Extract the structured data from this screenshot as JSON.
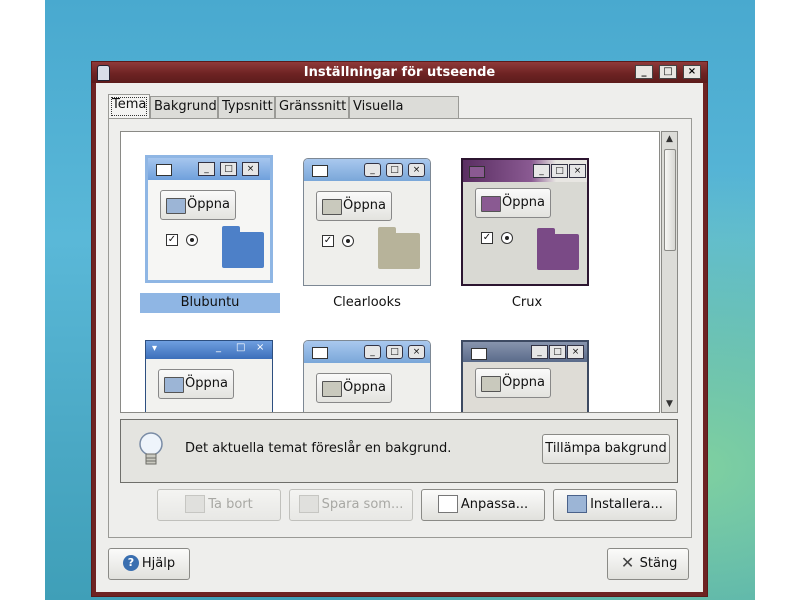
{
  "window": {
    "title": "Inställningar för utseende",
    "controls": {
      "minimize": "_",
      "maximize": "□",
      "close": "×"
    }
  },
  "tabs": [
    {
      "label": "Tema",
      "active": true
    },
    {
      "label": "Bakgrund"
    },
    {
      "label": "Typsnitt"
    },
    {
      "label": "Gränssnitt"
    },
    {
      "label": "Visuella effekter"
    }
  ],
  "themes": [
    {
      "name": "Blubuntu",
      "button_label": "Öppna",
      "selected": true,
      "colors": {
        "frame": "#6fa0dc",
        "folder": "#4d80c8"
      }
    },
    {
      "name": "Clearlooks",
      "button_label": "Öppna",
      "colors": {
        "frame": "#7aa7d9",
        "folder": "#b7b39a"
      }
    },
    {
      "name": "Crux",
      "button_label": "Öppna",
      "colors": {
        "frame": "#5a2e62",
        "folder": "#7a4a86"
      }
    },
    {
      "name": "",
      "button_label": "Öppna",
      "colors": {
        "frame": "#4c83cc"
      }
    },
    {
      "name": "",
      "button_label": "Öppna",
      "colors": {
        "frame": "#7aa7d9"
      }
    },
    {
      "name": "",
      "button_label": "Öppna",
      "colors": {
        "frame": "#5a6b8a"
      }
    }
  ],
  "info": {
    "text": "Det aktuella temat föreslår en bakgrund.",
    "apply_background_label": "Tillämpa bakgrund"
  },
  "actions": {
    "remove_label": "Ta bort",
    "save_as_label": "Spara som...",
    "customize_label": "Anpassa...",
    "install_label": "Installera..."
  },
  "footer": {
    "help_label": "Hjälp",
    "close_label": "Stäng"
  }
}
